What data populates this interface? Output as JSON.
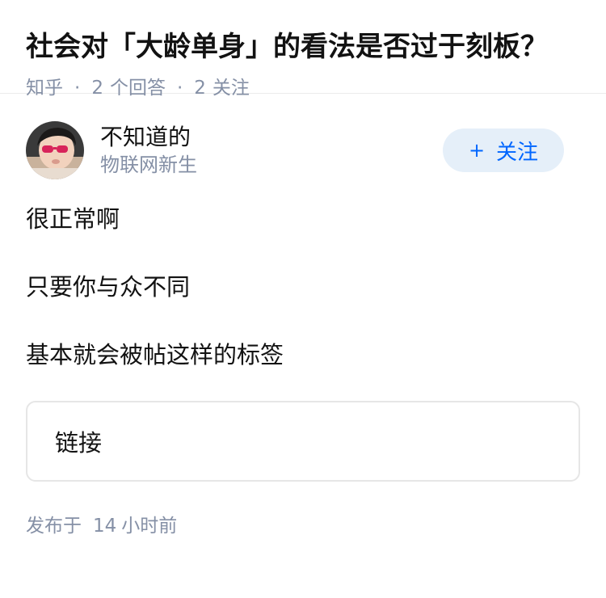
{
  "question": {
    "title": "社会对「大龄单身」的看法是否过于刻板？",
    "meta": {
      "source": "知乎",
      "separator": "·",
      "answer_count": "2",
      "answer_label": "个回答",
      "follower_count": "2",
      "follower_label": "关注"
    }
  },
  "answer": {
    "author": {
      "name": "不知道的",
      "bio": "物联网新生",
      "avatar_icon": "child-with-sunglasses-avatar"
    },
    "follow_button": {
      "plus": "+",
      "label": "关注"
    },
    "paragraphs": [
      "很正常啊",
      "只要你与众不同",
      "基本就会被帖这样的标签"
    ],
    "link_card": {
      "label": "链接"
    },
    "publish": {
      "label": "发布于",
      "value": "14",
      "unit": "小时前"
    }
  },
  "colors": {
    "meta_gray": "#8590a6",
    "follow_bg": "#e5eff9",
    "follow_text": "#0066ff",
    "divider": "#ebebeb",
    "card_border": "#e6e6e6"
  }
}
